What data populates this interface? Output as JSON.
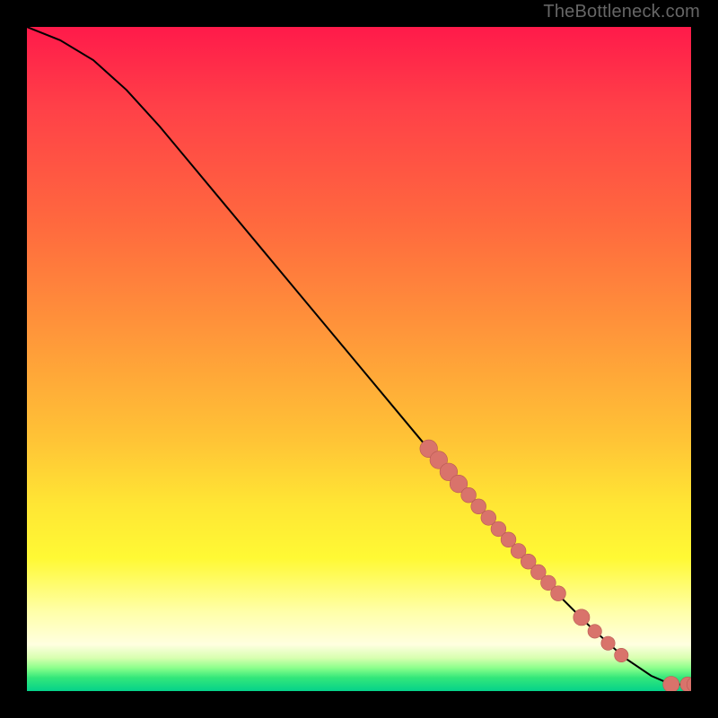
{
  "attribution": "TheBottleneck.com",
  "colors": {
    "background": "#000000",
    "curve": "#000000",
    "marker_fill": "#d9736b",
    "marker_stroke": "#b85a52",
    "gradient_top": "#ff1a4a",
    "gradient_bottom": "#05d28a"
  },
  "chart_data": {
    "type": "line",
    "title": "",
    "xlabel": "",
    "ylabel": "",
    "xlim": [
      0,
      100
    ],
    "ylim": [
      0,
      100
    ],
    "series": [
      {
        "name": "curve",
        "x": [
          0,
          5,
          10,
          15,
          20,
          25,
          30,
          35,
          40,
          45,
          50,
          55,
          60,
          65,
          70,
          75,
          80,
          85,
          90,
          94,
          97,
          100
        ],
        "y": [
          100,
          98,
          95,
          90.5,
          85,
          79,
          73,
          67,
          61,
          55,
          49,
          43,
          37,
          31,
          25.5,
          20,
          14.5,
          9.5,
          5,
          2.3,
          1.0,
          1.0
        ]
      }
    ],
    "markers": [
      {
        "x": 60.5,
        "y": 36.5,
        "r": 1.4
      },
      {
        "x": 62.0,
        "y": 34.8,
        "r": 1.4
      },
      {
        "x": 63.5,
        "y": 33.0,
        "r": 1.4
      },
      {
        "x": 65.0,
        "y": 31.2,
        "r": 1.4
      },
      {
        "x": 66.5,
        "y": 29.5,
        "r": 1.2
      },
      {
        "x": 68.0,
        "y": 27.8,
        "r": 1.2
      },
      {
        "x": 69.5,
        "y": 26.1,
        "r": 1.2
      },
      {
        "x": 71.0,
        "y": 24.4,
        "r": 1.2
      },
      {
        "x": 72.5,
        "y": 22.8,
        "r": 1.2
      },
      {
        "x": 74.0,
        "y": 21.1,
        "r": 1.2
      },
      {
        "x": 75.5,
        "y": 19.5,
        "r": 1.2
      },
      {
        "x": 77.0,
        "y": 17.9,
        "r": 1.2
      },
      {
        "x": 78.5,
        "y": 16.3,
        "r": 1.2
      },
      {
        "x": 80.0,
        "y": 14.7,
        "r": 1.2
      },
      {
        "x": 83.5,
        "y": 11.1,
        "r": 1.3
      },
      {
        "x": 85.5,
        "y": 9.0,
        "r": 1.1
      },
      {
        "x": 87.5,
        "y": 7.2,
        "r": 1.1
      },
      {
        "x": 89.5,
        "y": 5.4,
        "r": 1.1
      },
      {
        "x": 97.0,
        "y": 1.0,
        "r": 1.3
      },
      {
        "x": 99.5,
        "y": 1.0,
        "r": 1.2
      },
      {
        "x": 100.5,
        "y": 1.0,
        "r": 1.2
      }
    ]
  }
}
